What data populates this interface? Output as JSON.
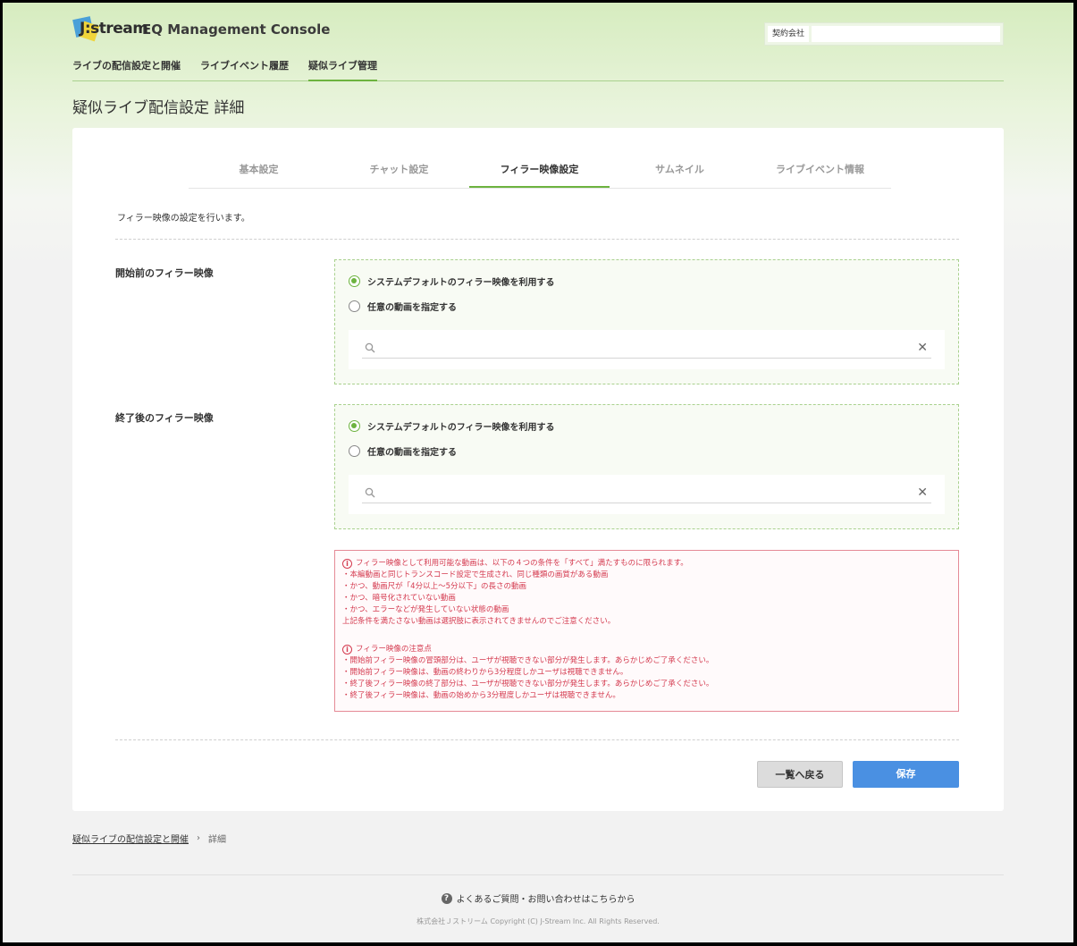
{
  "header": {
    "logo_text": "J:stream",
    "app_title": "EQ Management Console",
    "company_label": "契約会社",
    "company_value": "",
    "nav": [
      {
        "label": "ライブの配信設定と開催"
      },
      {
        "label": "ライブイベント履歴"
      },
      {
        "label": "疑似ライブ管理"
      }
    ]
  },
  "page_title": "疑似ライブ配信設定 詳細",
  "tabs": [
    {
      "label": "基本設定"
    },
    {
      "label": "チャット設定"
    },
    {
      "label": "フィラー映像設定"
    },
    {
      "label": "サムネイル"
    },
    {
      "label": "ライブイベント情報"
    }
  ],
  "intro": "フィラー映像の設定を行います。",
  "sections": [
    {
      "label": "開始前のフィラー映像",
      "option_default": "システムデフォルトのフィラー映像を利用する",
      "option_custom": "任意の動画を指定する",
      "search_value": ""
    },
    {
      "label": "終了後のフィラー映像",
      "option_default": "システムデフォルトのフィラー映像を利用する",
      "option_custom": "任意の動画を指定する",
      "search_value": ""
    }
  ],
  "notice": {
    "head1": "フィラー映像として利用可能な動画は、以下の４つの条件を「すべて」満たすものに限られます。",
    "lines1": [
      "・本編動画と同じトランスコード設定で生成され、同じ種類の画質がある動画",
      "・かつ、動画尺が「4分以上～5分以下」の長さの動画",
      "・かつ、暗号化されていない動画",
      "・かつ、エラーなどが発生していない状態の動画",
      "上記条件を満たさない動画は選択肢に表示されてきませんのでご注意ください。"
    ],
    "head2": "フィラー映像の注意点",
    "lines2": [
      "・開始前フィラー映像の冒頭部分は、ユーザが視聴できない部分が発生します。あらかじめご了承ください。",
      "・開始前フィラー映像は、動画の終わりから3分程度しかユーザは視聴できません。",
      "・終了後フィラー映像の終了部分は、ユーザが視聴できない部分が発生します。あらかじめご了承ください。",
      "・終了後フィラー映像は、動画の始めから3分程度しかユーザは視聴できません。"
    ]
  },
  "buttons": {
    "back": "一覧へ戻る",
    "save": "保存"
  },
  "breadcrumb": {
    "parent": "疑似ライブの配信設定と開催",
    "current": "詳細"
  },
  "footer": {
    "help": "よくあるご質問・お問い合わせはこちらから",
    "copyright": "株式会社Ｊストリーム Copyright (C) J-Stream Inc. All Rights Reserved."
  },
  "colors": {
    "accent_green": "#6db33f",
    "save_blue": "#4a90e2",
    "notice_red": "#d43a4f"
  }
}
